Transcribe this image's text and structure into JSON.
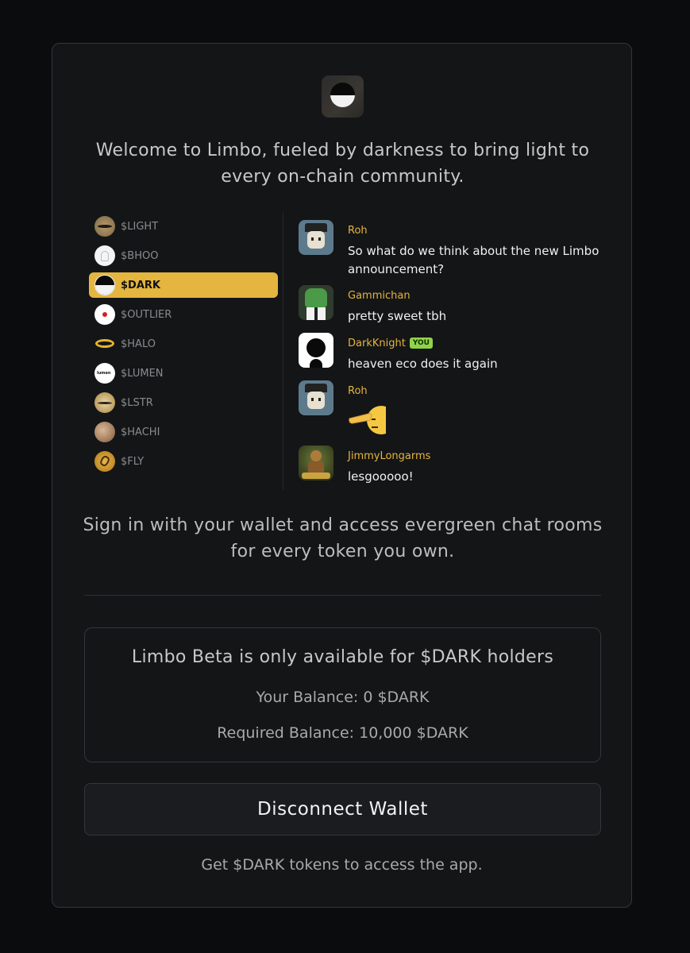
{
  "welcome_text": "Welcome to Limbo, fueled by darkness to bring light to every on-chain community.",
  "tokens": [
    {
      "label": "$LIGHT",
      "active": false
    },
    {
      "label": "$BHOO",
      "active": false
    },
    {
      "label": "$DARK",
      "active": true
    },
    {
      "label": "$OUTLIER",
      "active": false
    },
    {
      "label": "$HALO",
      "active": false
    },
    {
      "label": "$LUMEN",
      "active": false
    },
    {
      "label": "$LSTR",
      "active": false
    },
    {
      "label": "$HACHI",
      "active": false
    },
    {
      "label": "$FLY",
      "active": false
    }
  ],
  "chat": [
    {
      "name": "Roh",
      "text": "So what do we think about the new Limbo announcement?"
    },
    {
      "name": "Gammichan",
      "text": "pretty sweet tbh"
    },
    {
      "name": "DarkKnight",
      "badge": "YOU",
      "text": "heaven eco does it again"
    },
    {
      "name": "Roh",
      "emoji": "saluting-face"
    },
    {
      "name": "JimmyLongarms",
      "text": "lesgooooo!"
    }
  ],
  "lumen_logo_text": "lumen",
  "signin_text": "Sign in with your wallet and access evergreen chat rooms for every token you own.",
  "beta": {
    "title": "Limbo Beta is only available for $DARK holders",
    "balance": "Your Balance: 0 $DARK",
    "required": "Required Balance: 10,000 $DARK"
  },
  "disconnect_label": "Disconnect Wallet",
  "footer_text": "Get $DARK tokens to access the app.",
  "colors": {
    "accent": "#e4b53f",
    "you_badge": "#8fd34a",
    "background": "#0b0c0e",
    "card": "#141517"
  }
}
